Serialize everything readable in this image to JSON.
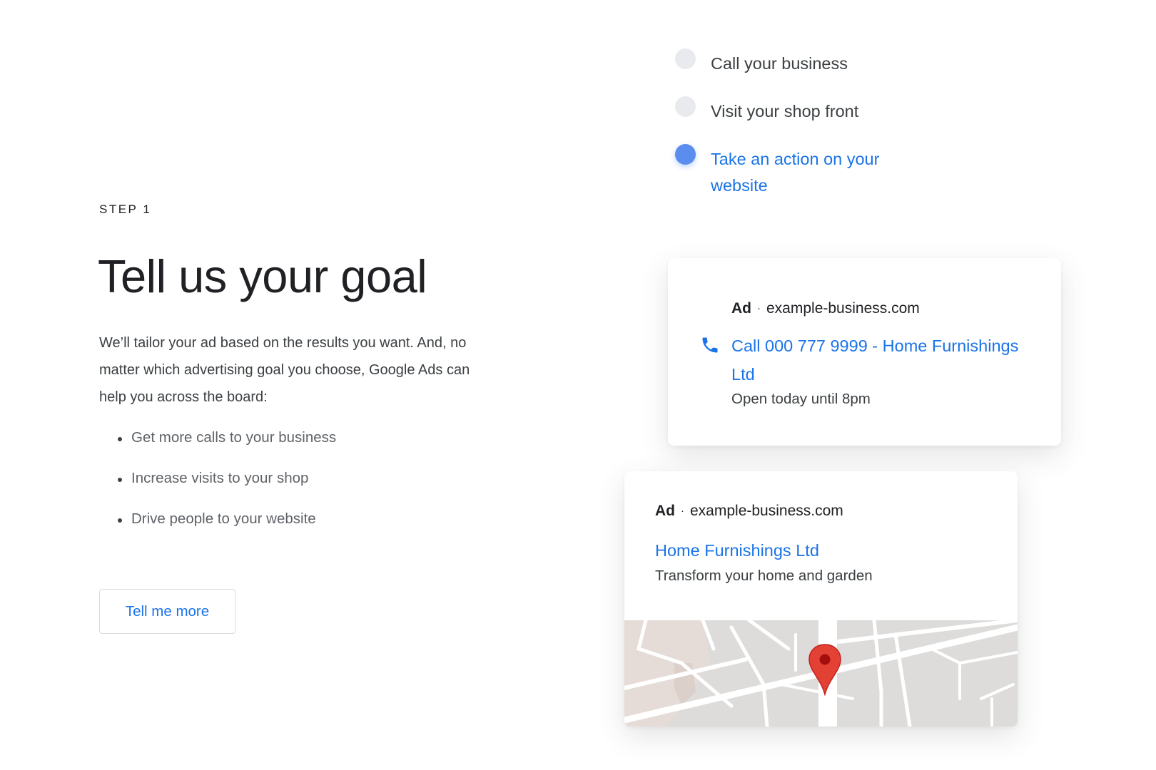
{
  "step": {
    "label": "STEP 1"
  },
  "headline": "Tell us your goal",
  "description": "We’ll tailor your ad based on the results you want. And, no matter which advertising goal you choose, Google Ads can help you across the board:",
  "benefits": [
    "Get more calls to your business",
    "Increase visits to your shop",
    "Drive people to your website"
  ],
  "cta_label": "Tell me more",
  "goal_options": [
    {
      "label": "Call your business",
      "selected": false
    },
    {
      "label": "Visit your shop front",
      "selected": false
    },
    {
      "label": "Take an action on your website",
      "selected": true
    }
  ],
  "call_ad": {
    "badge": "Ad",
    "separator": "·",
    "domain": "example-business.com",
    "title": "Call 000 777 9999 - Home Furnishings Ltd",
    "subtitle": "Open today until 8pm",
    "icon": "phone-icon"
  },
  "store_ad": {
    "badge": "Ad",
    "separator": "·",
    "domain": "example-business.com",
    "title": "Home Furnishings Ltd",
    "subtitle": "Transform your home and garden",
    "map_icon": "map-pin-icon"
  },
  "colors": {
    "accent": "#1a73e8",
    "selected_radio": "#5b8def",
    "unselected_radio": "#e8eaed",
    "map_pin": "#e34133",
    "text_primary": "#202124",
    "text_secondary": "#5f6368"
  }
}
